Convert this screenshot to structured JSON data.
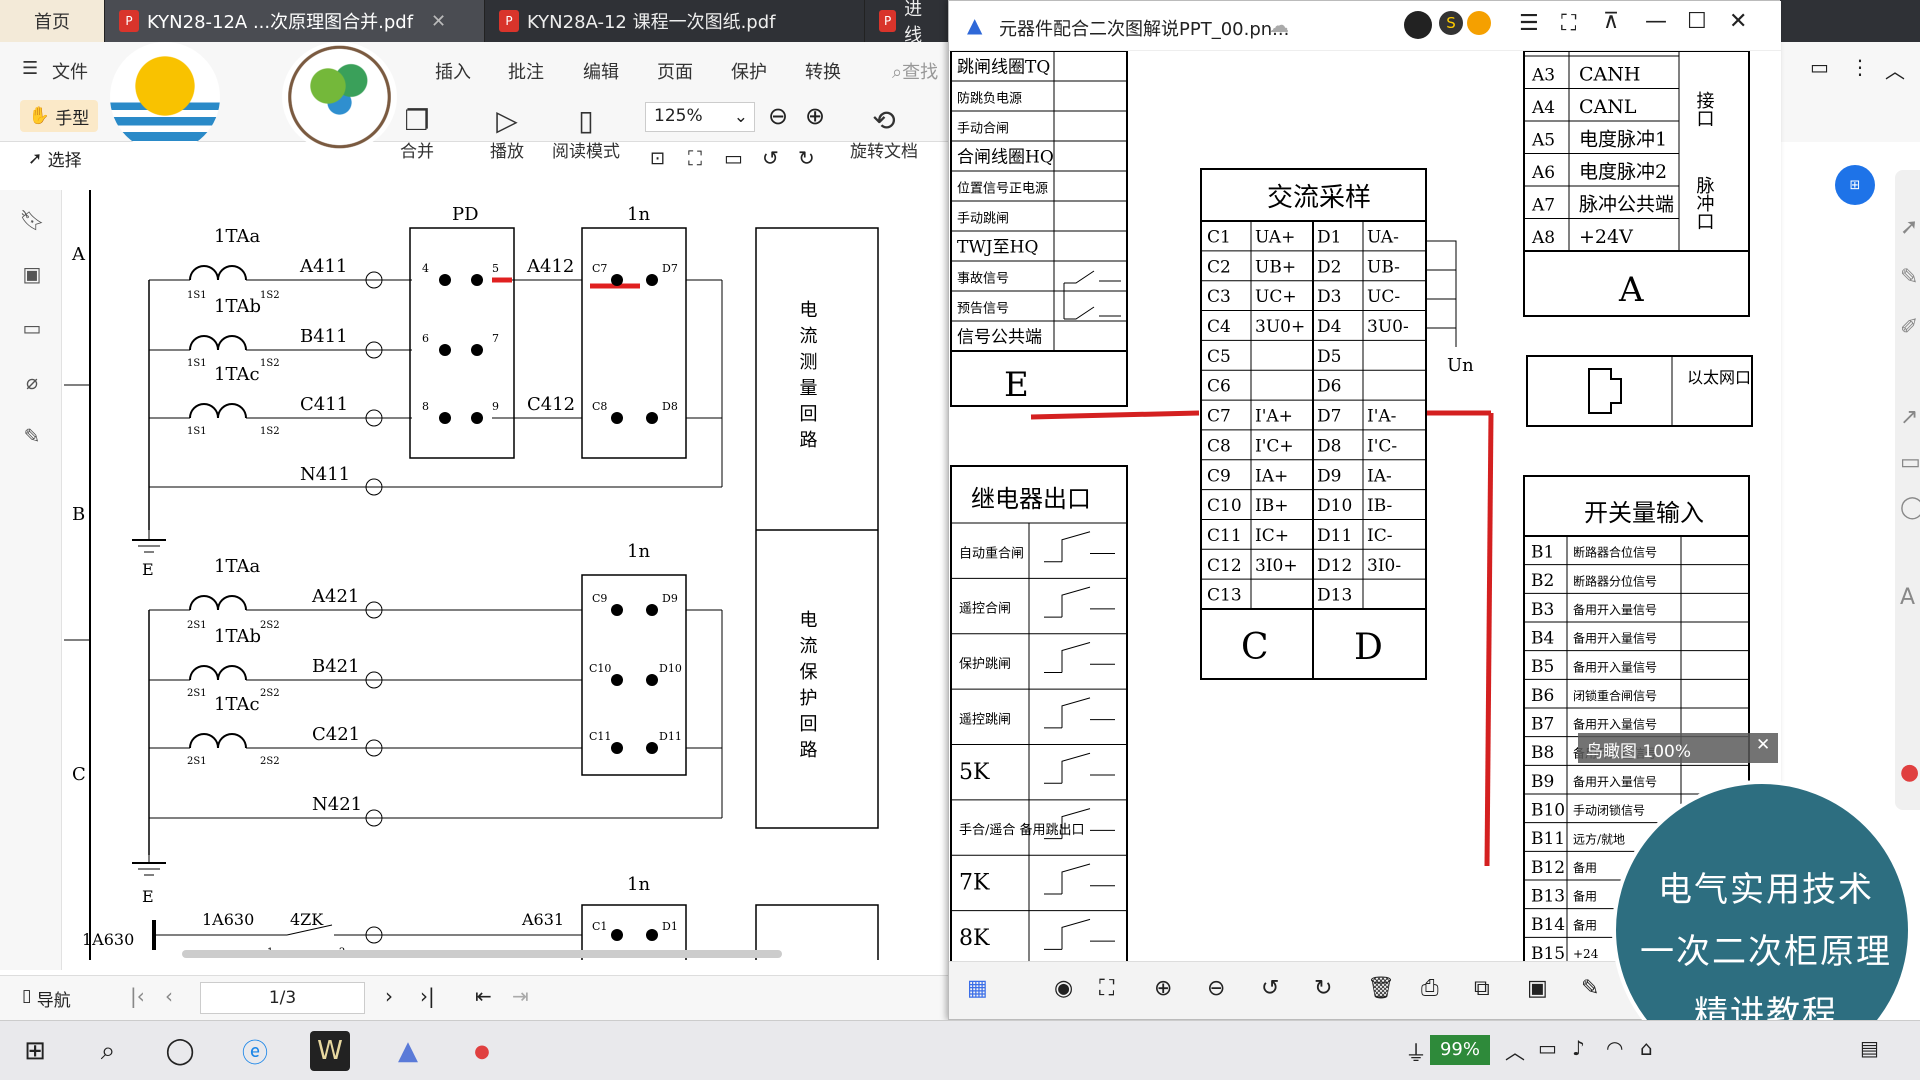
{
  "tabs": [
    {
      "label": "首页"
    },
    {
      "label": "KYN28-12A ...次原理图合并.pdf"
    },
    {
      "label": "KYN28A-12 课程一次图纸.pdf"
    },
    {
      "label": "进线"
    }
  ],
  "menus": [
    "文件",
    "插入",
    "批注",
    "编辑",
    "页面",
    "保护",
    "转换"
  ],
  "search_placeholder": "查找",
  "tools": {
    "hand": "手型",
    "select": "选择",
    "merge": "合并",
    "play": "播放",
    "read": "阅读模式",
    "zoom": "125%",
    "rotate": "旋转文档"
  },
  "pdf_status": {
    "nav": "导航",
    "page": "1/3"
  },
  "schematic": {
    "rows": [
      "A",
      "B",
      "C"
    ],
    "ct_meas": [
      {
        "name": "1TAa",
        "wire": "A411"
      },
      {
        "name": "1TAb",
        "wire": "B411"
      },
      {
        "name": "1TAc",
        "wire": "C411"
      }
    ],
    "ct_prot": [
      {
        "name": "1TAa",
        "wire": "A421"
      },
      {
        "name": "1TAb",
        "wire": "B421"
      },
      {
        "name": "1TAc",
        "wire": "C421"
      }
    ],
    "pd": "PD",
    "ln": "1n",
    "ct_pins": [
      "1S1",
      "1S2",
      "2S1",
      "2S2"
    ],
    "w_a412": "A412",
    "w_c412": "C412",
    "w_n411": "N411",
    "w_n421": "N421",
    "ground": "E",
    "box1": "电流测量回路",
    "box2": "电流保护回路",
    "bottom": {
      "a": "1A630",
      "b": "1A630",
      "c": "4ZK",
      "d": "A631"
    },
    "term_pd": [
      "4",
      "5",
      "6",
      "7",
      "8",
      "9"
    ],
    "term_ln1": [
      "C7",
      "D7",
      "C8",
      "D8"
    ],
    "term_ln2": [
      "C9",
      "D9",
      "C10",
      "D10",
      "C11",
      "D11"
    ],
    "term_ln3": [
      "C1",
      "D1"
    ],
    "pins12": [
      "1",
      "2"
    ]
  },
  "viewer": {
    "title": "元器件配合二次图解说PPT_00.pn...",
    "minimap_label": "鸟瞰图 100%",
    "left_labels": [
      "跳闸线圈TQ",
      "防跳负电源",
      "手动合闸",
      "合闸线圈HQ",
      "位置信号正电源",
      "手动跳闸",
      "TWJ至HQ",
      "事故信号",
      "预告信号",
      "信号公共端"
    ],
    "box_e": "E",
    "relay_title": "继电器出口",
    "relay_items": [
      "自动重合闸",
      "遥控合闸",
      "保护跳闸",
      "遥控跳闸",
      "5K",
      "手合/遥合 备用跳出口",
      "7K",
      "8K"
    ],
    "ac_title": "交流采样",
    "ac_rows": [
      [
        "C1",
        "UA+",
        "D1",
        "UA-"
      ],
      [
        "C2",
        "UB+",
        "D2",
        "UB-"
      ],
      [
        "C3",
        "UC+",
        "D3",
        "UC-"
      ],
      [
        "C4",
        "3U0+",
        "D4",
        "3U0-"
      ],
      [
        "C5",
        "",
        "D5",
        ""
      ],
      [
        "C6",
        "",
        "D6",
        ""
      ],
      [
        "C7",
        "I'A+",
        "D7",
        "I'A-"
      ],
      [
        "C8",
        "I'C+",
        "D8",
        "I'C-"
      ],
      [
        "C9",
        "IA+",
        "D9",
        "IA-"
      ],
      [
        "C10",
        "IB+",
        "D10",
        "IB-"
      ],
      [
        "C11",
        "IC+",
        "D11",
        "IC-"
      ],
      [
        "C12",
        "3I0+",
        "D12",
        "3I0-"
      ],
      [
        "C13",
        "",
        "D13",
        ""
      ]
    ],
    "ac_foot": [
      "C",
      "D"
    ],
    "un": "Un",
    "a_rows": [
      [
        "A3",
        "CANH"
      ],
      [
        "A4",
        "CANL"
      ],
      [
        "A5",
        "电度脉冲1"
      ],
      [
        "A6",
        "电度脉冲2"
      ],
      [
        "A7",
        "脉冲公共端"
      ],
      [
        "A8",
        "+24V"
      ]
    ],
    "a_side1": "接口",
    "a_side2": "脉冲口",
    "a_foot": "A",
    "eth": "以太网口",
    "sw_title": "开关量输入",
    "sw_rows": [
      [
        "B1",
        "断路器合位信号"
      ],
      [
        "B2",
        "断路器分位信号"
      ],
      [
        "B3",
        "备用开入量信号"
      ],
      [
        "B4",
        "备用开入量信号"
      ],
      [
        "B5",
        "备用开入量信号"
      ],
      [
        "B6",
        "闭锁重合闸信号"
      ],
      [
        "B7",
        "备用开入量信号"
      ],
      [
        "B8",
        "备用开入量信号"
      ],
      [
        "B9",
        "备用开入量信号"
      ],
      [
        "B10",
        "手动闭锁信号"
      ],
      [
        "B11",
        "远方/就地"
      ],
      [
        "B12",
        "备用"
      ],
      [
        "B13",
        "备用"
      ],
      [
        "B14",
        "备用"
      ],
      [
        "B15",
        "+24"
      ]
    ]
  },
  "promo": [
    "电气实用技术",
    "一次二次柜原理",
    "精讲教程"
  ],
  "taskbar": {
    "battery": "99%"
  }
}
